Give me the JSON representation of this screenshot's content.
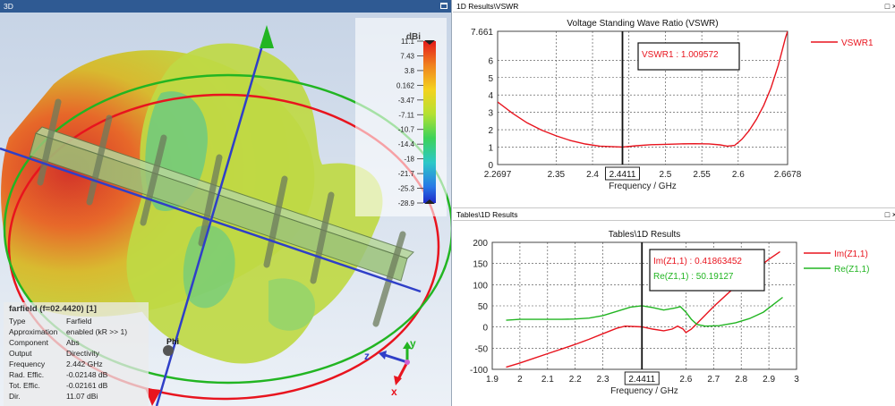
{
  "panes": {
    "view3d": {
      "title": "3D"
    },
    "vswr": {
      "title": "1D Results\\VSWR"
    },
    "tables": {
      "title": "Tables\\1D Results"
    }
  },
  "view3d": {
    "colorbar": {
      "unit": "dBi",
      "ticks": [
        "11.1",
        "7.43",
        "3.8",
        "0.162",
        "-3.47",
        "-7.11",
        "-10.7",
        "-14.4",
        "-18",
        "-21.7",
        "-25.3",
        "-28.9"
      ]
    },
    "axes": {
      "x": "x",
      "y": "y",
      "z": "z",
      "phi": "Phi"
    },
    "info": {
      "heading": "farfield (f=02.4420) [1]",
      "rows": [
        {
          "key": "Type",
          "value": "Farfield"
        },
        {
          "key": "Approximation",
          "value": "enabled (kR >> 1)"
        },
        {
          "key": "Component",
          "value": "Abs"
        },
        {
          "key": "Output",
          "value": "Directivity"
        },
        {
          "key": "Frequency",
          "value": "2.442 GHz"
        },
        {
          "key": "Rad. Effic.",
          "value": "-0.02148 dB"
        },
        {
          "key": "Tot. Effic.",
          "value": "-0.02161 dB"
        },
        {
          "key": "Dir.",
          "value": "11.07 dBi"
        }
      ]
    }
  },
  "chart_data": [
    {
      "type": "line",
      "title": "Voltage Standing Wave Ratio (VSWR)",
      "xlabel": "Frequency / GHz",
      "ylabel": "",
      "xlim": [
        2.2697,
        2.6678
      ],
      "ylim": [
        0,
        7.661
      ],
      "x_ticks": [
        "2.2697",
        "2.35",
        "2.4",
        "2.45",
        "2.5",
        "2.55",
        "2.6",
        "2.6678"
      ],
      "y_ticks": [
        "0",
        "1",
        "2",
        "3",
        "4",
        "5",
        "6",
        "7.661"
      ],
      "marker": {
        "x": 2.4411,
        "label": "2.4411",
        "annotation": "VSWR1 : 1.009572"
      },
      "grid": true,
      "legend": "right",
      "series": [
        {
          "name": "VSWR1",
          "color": "#e8141e",
          "points": [
            [
              2.2697,
              3.6
            ],
            [
              2.29,
              2.95
            ],
            [
              2.31,
              2.4
            ],
            [
              2.33,
              1.98
            ],
            [
              2.35,
              1.65
            ],
            [
              2.37,
              1.38
            ],
            [
              2.39,
              1.18
            ],
            [
              2.41,
              1.06
            ],
            [
              2.4411,
              1.0096
            ],
            [
              2.46,
              1.08
            ],
            [
              2.48,
              1.14
            ],
            [
              2.5,
              1.16
            ],
            [
              2.52,
              1.19
            ],
            [
              2.54,
              1.2
            ],
            [
              2.56,
              1.19
            ],
            [
              2.575,
              1.13
            ],
            [
              2.585,
              1.06
            ],
            [
              2.595,
              1.1
            ],
            [
              2.605,
              1.45
            ],
            [
              2.615,
              1.95
            ],
            [
              2.625,
              2.6
            ],
            [
              2.635,
              3.4
            ],
            [
              2.645,
              4.4
            ],
            [
              2.655,
              5.7
            ],
            [
              2.665,
              7.3
            ],
            [
              2.6678,
              7.661
            ]
          ]
        }
      ]
    },
    {
      "type": "line",
      "title": "Tables\\1D Results",
      "xlabel": "Frequency / GHz",
      "ylabel": "",
      "xlim": [
        1.9,
        3.0
      ],
      "ylim": [
        -100,
        200
      ],
      "x_ticks": [
        "1.9",
        "2",
        "2.1",
        "2.2",
        "2.3",
        "2.4411",
        "2.6",
        "2.7",
        "2.8",
        "2.9",
        "3"
      ],
      "y_ticks": [
        "-100",
        "-50",
        "0",
        "50",
        "100",
        "150",
        "200"
      ],
      "marker": {
        "x": 2.4411,
        "label": "2.4411",
        "annotations": [
          "Im(Z1,1) : 0.41863452",
          "Re(Z1,1) : 50.19127"
        ]
      },
      "grid": true,
      "legend": "right",
      "series": [
        {
          "name": "Im(Z1,1)",
          "color": "#e8141e",
          "points": [
            [
              1.95,
              -95
            ],
            [
              2.0,
              -85
            ],
            [
              2.05,
              -74
            ],
            [
              2.1,
              -63
            ],
            [
              2.15,
              -52
            ],
            [
              2.2,
              -41
            ],
            [
              2.25,
              -29
            ],
            [
              2.3,
              -16
            ],
            [
              2.35,
              -3
            ],
            [
              2.38,
              2
            ],
            [
              2.4411,
              0.42
            ],
            [
              2.48,
              -5
            ],
            [
              2.52,
              -9
            ],
            [
              2.55,
              -5
            ],
            [
              2.57,
              2
            ],
            [
              2.59,
              -5
            ],
            [
              2.6,
              -13
            ],
            [
              2.62,
              -5
            ],
            [
              2.65,
              15
            ],
            [
              2.7,
              48
            ],
            [
              2.75,
              78
            ],
            [
              2.8,
              108
            ],
            [
              2.85,
              135
            ],
            [
              2.9,
              160
            ],
            [
              2.94,
              178
            ]
          ]
        },
        {
          "name": "Re(Z1,1)",
          "color": "#22b522",
          "points": [
            [
              1.95,
              16
            ],
            [
              2.0,
              18
            ],
            [
              2.05,
              18
            ],
            [
              2.1,
              18
            ],
            [
              2.15,
              18
            ],
            [
              2.2,
              19
            ],
            [
              2.25,
              21
            ],
            [
              2.3,
              27
            ],
            [
              2.35,
              37
            ],
            [
              2.4,
              47
            ],
            [
              2.4411,
              50.19
            ],
            [
              2.48,
              46
            ],
            [
              2.52,
              40
            ],
            [
              2.56,
              45
            ],
            [
              2.58,
              48
            ],
            [
              2.6,
              35
            ],
            [
              2.62,
              18
            ],
            [
              2.64,
              6
            ],
            [
              2.67,
              2
            ],
            [
              2.72,
              3
            ],
            [
              2.78,
              10
            ],
            [
              2.83,
              20
            ],
            [
              2.88,
              35
            ],
            [
              2.92,
              55
            ],
            [
              2.95,
              70
            ]
          ]
        }
      ]
    }
  ]
}
